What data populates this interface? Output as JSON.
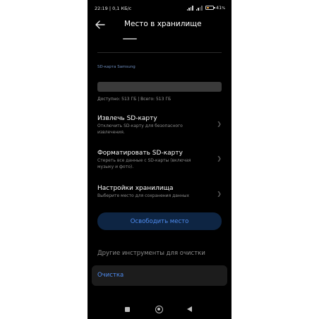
{
  "status_bar": {
    "time": "22:19",
    "speed": "0,1 КБ/с",
    "battery_percent": "41",
    "battery_level": 0.41,
    "battery_color": "#f1a23b"
  },
  "app_bar": {
    "back_icon": "arrow-left-icon",
    "title": "Место в хранилище"
  },
  "storage": {
    "section_label": "SD-карта Samsung",
    "used_fraction": 1.0,
    "info": "Доступно: 513 ГБ | Всего: 513 ГБ"
  },
  "items": [
    {
      "title": "Извлечь SD-карту",
      "description": "Отключить SD-карту для безопасного извлечения."
    },
    {
      "title": "Форматировать SD-карту",
      "description": "Стереть все данные с SD-карты (включая музыку и фото)."
    },
    {
      "title": "Настройки хранилища",
      "description": "Выберите место для сохранения данных"
    }
  ],
  "free_space_button": "Освободить место",
  "other_tools_heading": "Другие инструменты для очистки",
  "cleanup_item": "Очистка",
  "colors": {
    "accent": "#4f8cf0",
    "button_bg": "#0e2543",
    "background": "#000000"
  },
  "nav_bar": {
    "recents_icon": "square-icon",
    "home_icon": "circle-icon",
    "back_icon": "triangle-back-icon"
  }
}
